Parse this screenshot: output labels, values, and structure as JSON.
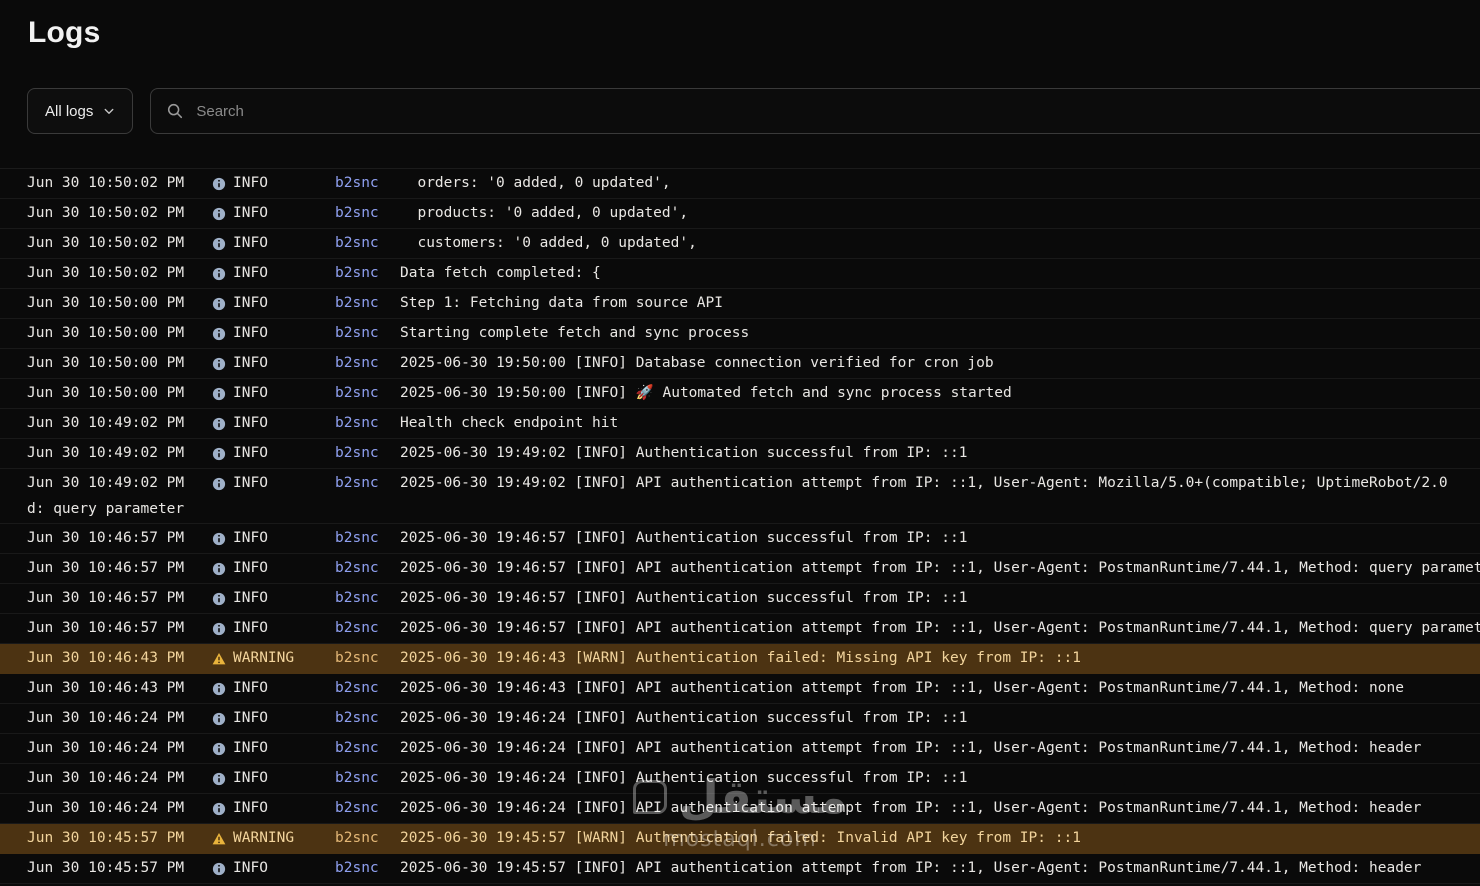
{
  "page": {
    "title": "Logs"
  },
  "filters": {
    "scope": {
      "label": "All logs"
    },
    "search": {
      "placeholder": "Search"
    }
  },
  "icons": {
    "scope_chevron": "chevron-down-icon",
    "search": "search-icon",
    "info": "info-icon",
    "warning": "warning-icon"
  },
  "colors": {
    "background": "#0a0a0a",
    "border": "#3a3a3a",
    "text": "#e9e7e4",
    "source_link": "#8fa0f0",
    "warning_row_bg": "#4c3312",
    "warning_text": "#f2d49c",
    "warning_icon": "#e8b33c"
  },
  "watermark": {
    "line1": "مستقل",
    "line2": "mostaql.com"
  },
  "logs": {
    "rows": [
      {
        "time": "Jun 30 10:50:02 PM",
        "level": "INFO",
        "source": "b2snc",
        "message": "  orders: '0 added, 0 updated',"
      },
      {
        "time": "Jun 30 10:50:02 PM",
        "level": "INFO",
        "source": "b2snc",
        "message": "  products: '0 added, 0 updated',"
      },
      {
        "time": "Jun 30 10:50:02 PM",
        "level": "INFO",
        "source": "b2snc",
        "message": "  customers: '0 added, 0 updated',"
      },
      {
        "time": "Jun 30 10:50:02 PM",
        "level": "INFO",
        "source": "b2snc",
        "message": "Data fetch completed: {"
      },
      {
        "time": "Jun 30 10:50:00 PM",
        "level": "INFO",
        "source": "b2snc",
        "message": "Step 1: Fetching data from source API"
      },
      {
        "time": "Jun 30 10:50:00 PM",
        "level": "INFO",
        "source": "b2snc",
        "message": "Starting complete fetch and sync process"
      },
      {
        "time": "Jun 30 10:50:00 PM",
        "level": "INFO",
        "source": "b2snc",
        "message": "2025-06-30 19:50:00 [INFO] Database connection verified for cron job"
      },
      {
        "time": "Jun 30 10:50:00 PM",
        "level": "INFO",
        "source": "b2snc",
        "message": "2025-06-30 19:50:00 [INFO] 🚀 Automated fetch and sync process started"
      },
      {
        "time": "Jun 30 10:49:02 PM",
        "level": "INFO",
        "source": "b2snc",
        "message": "Health check endpoint hit"
      },
      {
        "time": "Jun 30 10:49:02 PM",
        "level": "INFO",
        "source": "b2snc",
        "message": "2025-06-30 19:49:02 [INFO] Authentication successful from IP: ::1"
      },
      {
        "time": "Jun 30 10:49:02 PM",
        "level": "INFO",
        "source": "b2snc",
        "message": "2025-06-30 19:49:02 [INFO] API authentication attempt from IP: ::1, User-Agent: Mozilla/5.0+(compatible; UptimeRobot/2.0",
        "wrap": "d: query parameter"
      },
      {
        "time": "Jun 30 10:46:57 PM",
        "level": "INFO",
        "source": "b2snc",
        "message": "2025-06-30 19:46:57 [INFO] Authentication successful from IP: ::1"
      },
      {
        "time": "Jun 30 10:46:57 PM",
        "level": "INFO",
        "source": "b2snc",
        "message": "2025-06-30 19:46:57 [INFO] API authentication attempt from IP: ::1, User-Agent: PostmanRuntime/7.44.1, Method: query parameter"
      },
      {
        "time": "Jun 30 10:46:57 PM",
        "level": "INFO",
        "source": "b2snc",
        "message": "2025-06-30 19:46:57 [INFO] Authentication successful from IP: ::1"
      },
      {
        "time": "Jun 30 10:46:57 PM",
        "level": "INFO",
        "source": "b2snc",
        "message": "2025-06-30 19:46:57 [INFO] API authentication attempt from IP: ::1, User-Agent: PostmanRuntime/7.44.1, Method: query parameter"
      },
      {
        "time": "Jun 30 10:46:43 PM",
        "level": "WARNING",
        "source": "b2snc",
        "message": "2025-06-30 19:46:43 [WARN] Authentication failed: Missing API key from IP: ::1"
      },
      {
        "time": "Jun 30 10:46:43 PM",
        "level": "INFO",
        "source": "b2snc",
        "message": "2025-06-30 19:46:43 [INFO] API authentication attempt from IP: ::1, User-Agent: PostmanRuntime/7.44.1, Method: none"
      },
      {
        "time": "Jun 30 10:46:24 PM",
        "level": "INFO",
        "source": "b2snc",
        "message": "2025-06-30 19:46:24 [INFO] Authentication successful from IP: ::1"
      },
      {
        "time": "Jun 30 10:46:24 PM",
        "level": "INFO",
        "source": "b2snc",
        "message": "2025-06-30 19:46:24 [INFO] API authentication attempt from IP: ::1, User-Agent: PostmanRuntime/7.44.1, Method: header"
      },
      {
        "time": "Jun 30 10:46:24 PM",
        "level": "INFO",
        "source": "b2snc",
        "message": "2025-06-30 19:46:24 [INFO] Authentication successful from IP: ::1"
      },
      {
        "time": "Jun 30 10:46:24 PM",
        "level": "INFO",
        "source": "b2snc",
        "message": "2025-06-30 19:46:24 [INFO] API authentication attempt from IP: ::1, User-Agent: PostmanRuntime/7.44.1, Method: header"
      },
      {
        "time": "Jun 30 10:45:57 PM",
        "level": "WARNING",
        "source": "b2snc",
        "message": "2025-06-30 19:45:57 [WARN] Authentication failed: Invalid API key from IP: ::1"
      },
      {
        "time": "Jun 30 10:45:57 PM",
        "level": "INFO",
        "source": "b2snc",
        "message": "2025-06-30 19:45:57 [INFO] API authentication attempt from IP: ::1, User-Agent: PostmanRuntime/7.44.1, Method: header"
      }
    ]
  }
}
